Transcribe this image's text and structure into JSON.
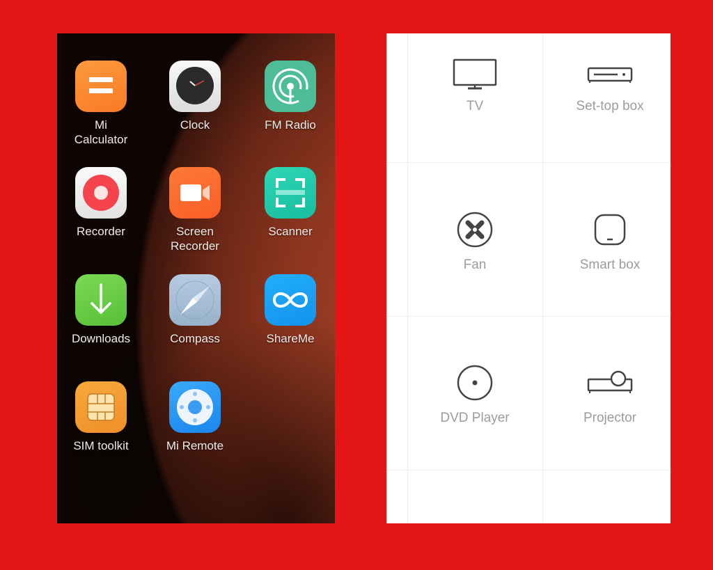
{
  "launcher": {
    "apps": [
      {
        "name": "Mi Calculator",
        "label": "Mi\nCalculator",
        "icon": "calculator-icon",
        "color": "#fb8a32"
      },
      {
        "name": "Clock",
        "label": "Clock",
        "icon": "clock-icon",
        "color": "#eeeeee"
      },
      {
        "name": "FM Radio",
        "label": "FM Radio",
        "icon": "radio-icon",
        "color": "#4dbc99"
      },
      {
        "name": "Recorder",
        "label": "Recorder",
        "icon": "recorder-icon",
        "color": "#f3f3f3"
      },
      {
        "name": "Screen Recorder",
        "label": "Screen\nRecorder",
        "icon": "screen-recorder-icon",
        "color": "#fb6a2c"
      },
      {
        "name": "Scanner",
        "label": "Scanner",
        "icon": "scanner-icon",
        "color": "#23c9aa"
      },
      {
        "name": "Downloads",
        "label": "Downloads",
        "icon": "download-icon",
        "color": "#6fd14a"
      },
      {
        "name": "Compass",
        "label": "Compass",
        "icon": "compass-icon",
        "color": "#a7bfd8"
      },
      {
        "name": "ShareMe",
        "label": "ShareMe",
        "icon": "infinity-icon",
        "color": "#18a3f5"
      },
      {
        "name": "SIM toolkit",
        "label": "SIM toolkit",
        "icon": "sim-card-icon",
        "color": "#f29b32"
      },
      {
        "name": "Mi Remote",
        "label": "Mi Remote",
        "icon": "remote-icon",
        "color": "#2a9cf5"
      }
    ]
  },
  "remote": {
    "devices": [
      {
        "label": "TV",
        "icon": "tv-icon"
      },
      {
        "label": "Set-top box",
        "icon": "set-top-box-icon"
      },
      {
        "label": "Fan",
        "icon": "fan-icon"
      },
      {
        "label": "Smart box",
        "icon": "smart-box-icon"
      },
      {
        "label": "DVD Player",
        "icon": "dvd-icon"
      },
      {
        "label": "Projector",
        "icon": "projector-icon"
      }
    ]
  },
  "colors": {
    "background": "#e41615",
    "device_label": "#9c9c9c",
    "device_icon": "#444444"
  }
}
